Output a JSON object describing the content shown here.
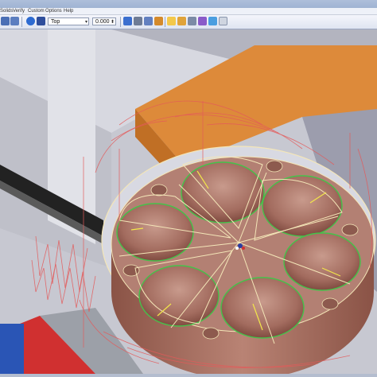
{
  "menu": {
    "items": [
      "Solids",
      "Verify",
      "Custom",
      "Options",
      "Help"
    ]
  },
  "toolbar": {
    "view_select": "Top",
    "value_field": "0.000",
    "dropdown_glyph": "▾",
    "spin_glyph": "⬍"
  },
  "colors": {
    "toolpath": "#e45a5a",
    "outline": "#f4e6b8",
    "pocket_ring": "#45c24a",
    "part": "#b07a6a",
    "fixture_orange": "#dd8a3a"
  },
  "icons": [
    "back-icon",
    "redo-icon",
    "info-icon",
    "clear-icon",
    "pan-icon",
    "zoom-icon",
    "rotate-icon",
    "home-icon",
    "fit-icon",
    "shaded-icon",
    "wire-icon",
    "settings-icon",
    "edit-icon",
    "grid-icon"
  ]
}
